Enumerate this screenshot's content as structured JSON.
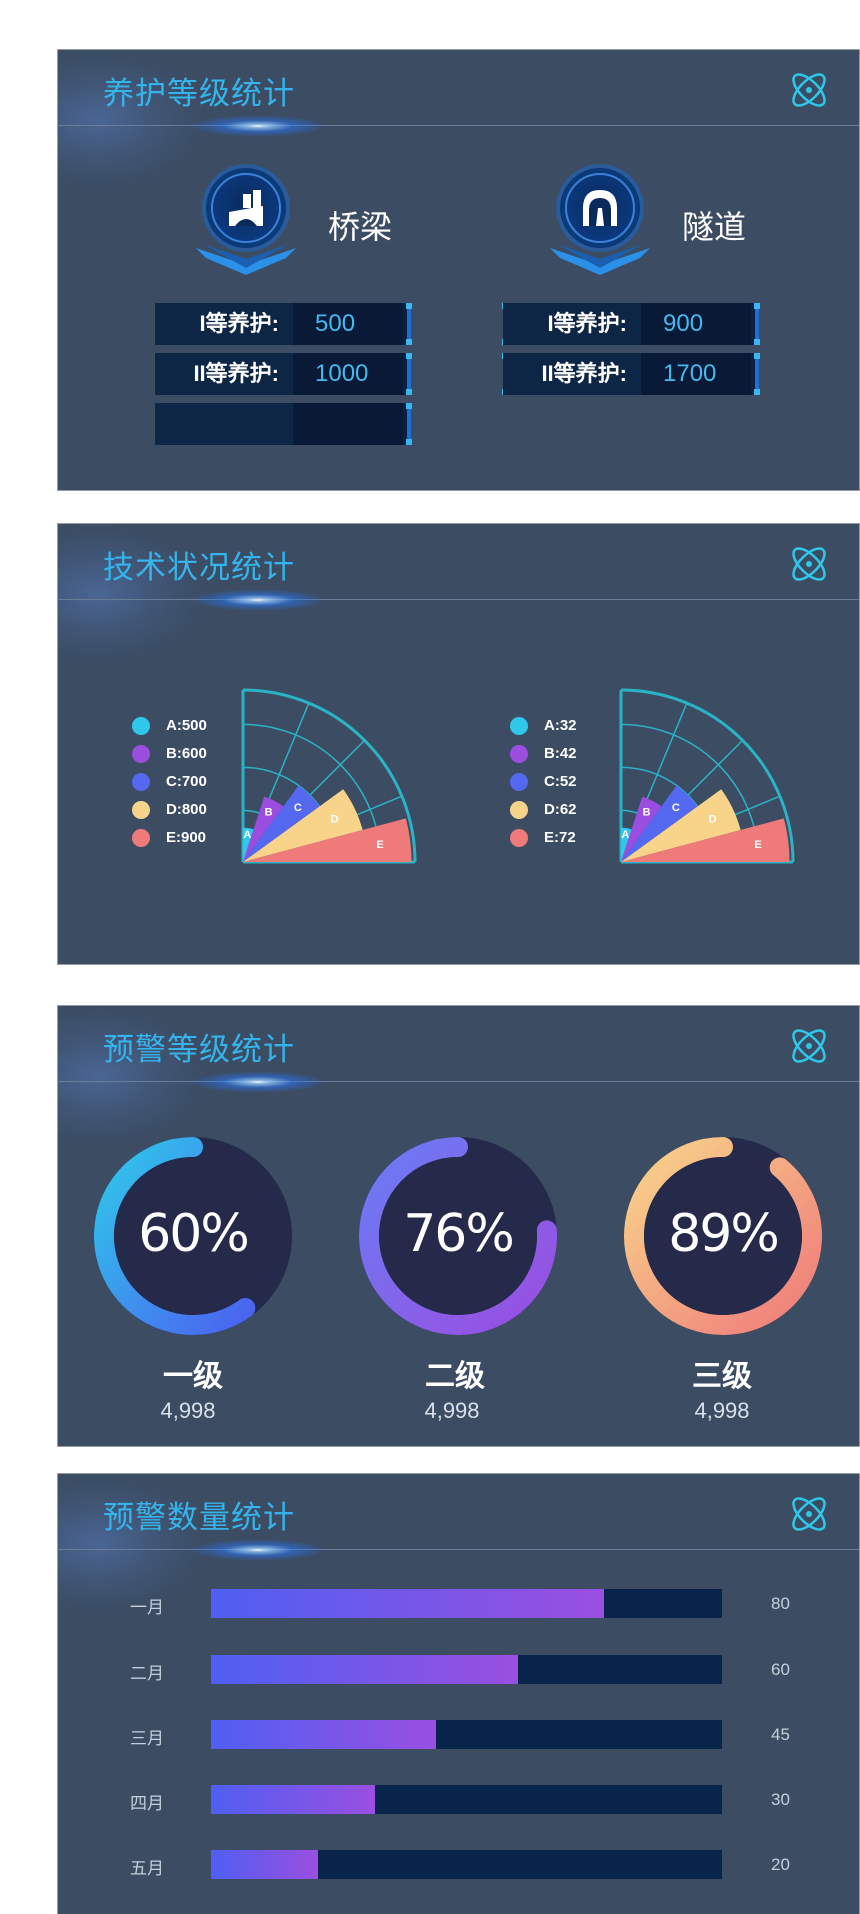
{
  "colors": {
    "panel_bg": "#3b4c63",
    "title": "#35b4ec",
    "value_blue": "#49b8f1",
    "A": "#2fc8ea",
    "B": "#9b4de0",
    "C": "#5469f0",
    "D": "#f8d48a",
    "E": "#ef7a7a"
  },
  "maintenance": {
    "title": "养护等级统计",
    "icon": "atom-icon",
    "bridge": {
      "name": "桥梁",
      "icon": "bridge-icon",
      "rows": [
        {
          "label": "I等养护:",
          "value": "500"
        },
        {
          "label": "II等养护:",
          "value": "1000"
        },
        {
          "label": "",
          "value": ""
        }
      ]
    },
    "tunnel": {
      "name": "隧道",
      "icon": "tunnel-icon",
      "rows": [
        {
          "label": "I等养护:",
          "value": "900"
        },
        {
          "label": "II等养护:",
          "value": "1700"
        }
      ]
    }
  },
  "technical": {
    "title": "技术状况统计",
    "icon": "atom-icon",
    "legend_left": [
      "A:500",
      "B:600",
      "C:700",
      "D:800",
      "E:900"
    ],
    "legend_right": [
      "A:32",
      "B:42",
      "C:52",
      "D:62",
      "E:72"
    ],
    "slice_letters": [
      "A",
      "B",
      "C",
      "D",
      "E"
    ]
  },
  "warning_level": {
    "title": "预警等级统计",
    "icon": "atom-icon",
    "gauges": [
      {
        "percent": "60%",
        "value": 60,
        "label": "一级",
        "count": "4,998",
        "start": "#2fc8ea",
        "end": "#4b63f0"
      },
      {
        "percent": "76%",
        "value": 76,
        "label": "二级",
        "count": "4,998",
        "start": "#6a7cf5",
        "end": "#9b4de0"
      },
      {
        "percent": "89%",
        "value": 89,
        "label": "三级",
        "count": "4,998",
        "start": "#f8d48a",
        "end": "#ef7a7a"
      }
    ]
  },
  "warning_count": {
    "title": "预警数量统计",
    "icon": "atom-icon",
    "rows": [
      {
        "label": "一月",
        "value": "80",
        "fill": 0.77
      },
      {
        "label": "二月",
        "value": "60",
        "fill": 0.6
      },
      {
        "label": "三月",
        "value": "45",
        "fill": 0.44
      },
      {
        "label": "四月",
        "value": "30",
        "fill": 0.32
      },
      {
        "label": "五月",
        "value": "20",
        "fill": 0.21
      }
    ]
  },
  "chart_data": [
    {
      "type": "pie",
      "categories": [
        "A",
        "B",
        "C",
        "D",
        "E"
      ],
      "values": [
        500,
        600,
        700,
        800,
        900
      ]
    },
    {
      "type": "pie",
      "categories": [
        "A",
        "B",
        "C",
        "D",
        "E"
      ],
      "values": [
        32,
        42,
        52,
        62,
        72
      ]
    },
    {
      "type": "bar",
      "categories": [
        "一月",
        "二月",
        "三月",
        "四月",
        "五月"
      ],
      "values": [
        80,
        60,
        45,
        30,
        20
      ]
    }
  ]
}
